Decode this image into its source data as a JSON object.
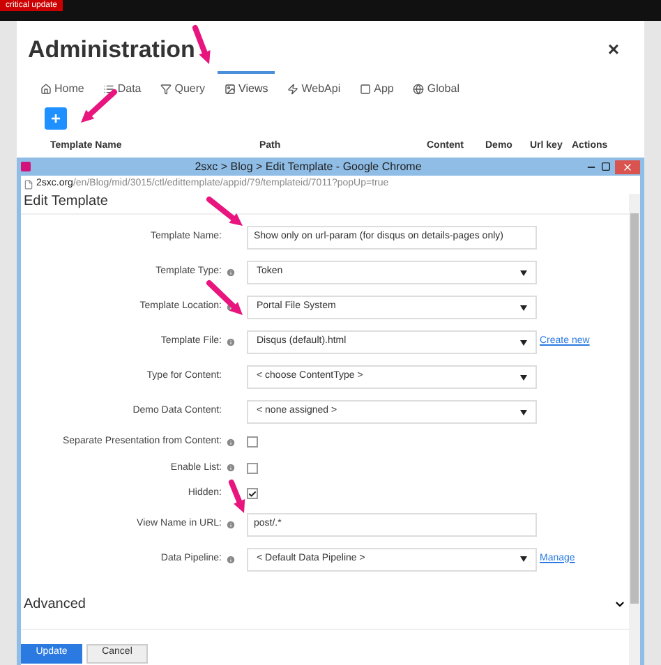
{
  "topbar": {
    "badge": "critical update"
  },
  "admin": {
    "title": "Administration",
    "close": "×",
    "tabs": [
      {
        "label": "Home",
        "selected": false
      },
      {
        "label": "Data",
        "selected": false
      },
      {
        "label": "Query",
        "selected": false
      },
      {
        "label": "Views",
        "selected": true
      },
      {
        "label": "WebApi",
        "selected": false
      },
      {
        "label": "App",
        "selected": false
      },
      {
        "label": "Global",
        "selected": false
      }
    ],
    "add_button": "+",
    "columns": [
      "Template Name",
      "Path",
      "Content",
      "Demo",
      "Url key",
      "Actions"
    ]
  },
  "popup": {
    "title": "2sxc > Blog > Edit Template - Google Chrome",
    "url_host": "2sxc.org",
    "url_path": "/en/Blog/mid/3015/ctl/edittemplate/appid/79/templateid/7011?popUp=true",
    "section": "Edit Template",
    "fields": [
      {
        "kind": "text",
        "label": "Template Name:",
        "info": false,
        "value": "Show only on url-param (for disqus on details-pages only)"
      },
      {
        "kind": "select",
        "label": "Template Type:",
        "info": true,
        "value": "Token"
      },
      {
        "kind": "select",
        "label": "Template Location:",
        "info": true,
        "value": "Portal File System"
      },
      {
        "kind": "select",
        "label": "Template File:",
        "info": true,
        "value": "Disqus (default).html",
        "link": "Create new"
      },
      {
        "kind": "select",
        "label": "Type for Content:",
        "info": false,
        "value": "< choose ContentType >"
      },
      {
        "kind": "select",
        "label": "Demo Data Content:",
        "info": false,
        "value": "< none assigned >"
      },
      {
        "kind": "checkbox",
        "label": "Separate Presentation from Content:",
        "info": true,
        "checked": false
      },
      {
        "kind": "checkbox",
        "label": "Enable List:",
        "info": true,
        "checked": false
      },
      {
        "kind": "checkbox",
        "label": "Hidden:",
        "info": false,
        "checked": true
      },
      {
        "kind": "text",
        "label": "View Name in URL:",
        "info": true,
        "value": "post/.*"
      },
      {
        "kind": "select",
        "label": "Data Pipeline:",
        "info": true,
        "value": "< Default Data Pipeline >",
        "link": "Manage"
      }
    ],
    "advanced": "Advanced",
    "buttons": [
      {
        "label": "Update",
        "primary": true
      },
      {
        "label": "Cancel",
        "primary": false
      }
    ]
  }
}
